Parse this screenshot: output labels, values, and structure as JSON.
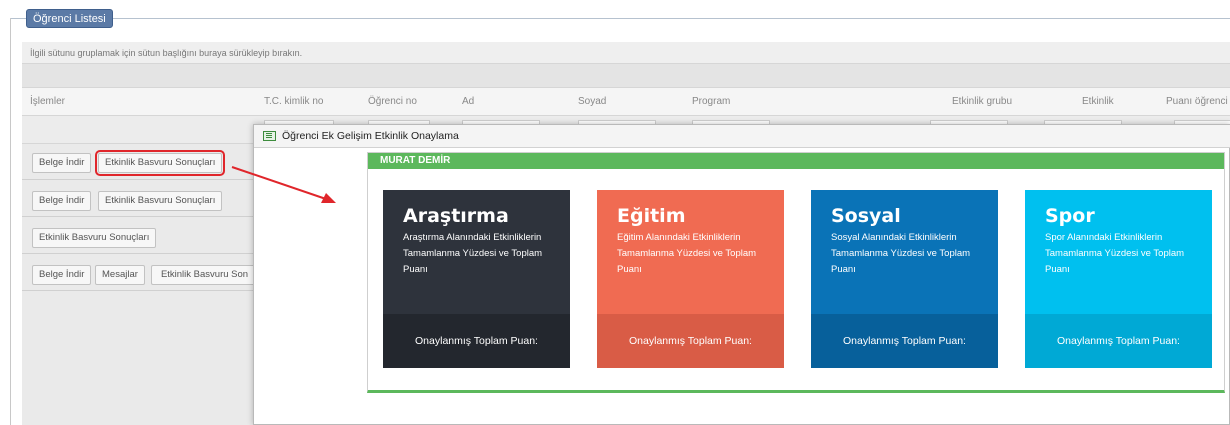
{
  "fieldset": {
    "legend": "Öğrenci Listesi"
  },
  "grid": {
    "group_hint": "İlgili sütunu gruplamak için sütun başlığını buraya sürükleyip bırakın.",
    "columns": [
      "İşlemler",
      "T.C. kimlik no",
      "Öğrenci no",
      "Ad",
      "Soyad",
      "Program",
      "Etkinlik grubu",
      "Etkinlik",
      "Puanı öğrenci"
    ],
    "rows": [
      {
        "buttons": [
          "Belge İndir",
          "Etkinlik Basvuru Sonuçları"
        ]
      },
      {
        "buttons": [
          "Belge İndir",
          "Etkinlik Basvuru Sonuçları"
        ]
      },
      {
        "buttons": [
          "Etkinlik Basvuru Sonuçları"
        ]
      },
      {
        "buttons": [
          "Belge İndir",
          "Mesajlar",
          "Etkinlik Basvuru Son"
        ]
      }
    ]
  },
  "modal": {
    "title": "Öğrenci Ek Gelişim Etkinlik Onaylama",
    "panel_header": "MURAT DEMİR",
    "cards": [
      {
        "title": "Araştırma",
        "description": "Araştırma Alanındaki Etkinliklerin Tamamlanma Yüzdesi ve Toplam Puanı",
        "footer": "Onaylanmış Toplam Puan:",
        "color": "#2e333c",
        "footer_color": "#23272e",
        "desc_color": "#ffffff"
      },
      {
        "title": "Eğitim",
        "description": "Eğitim Alanındaki Etkinliklerin Tamamlanma Yüzdesi ve Toplam Puanı",
        "footer": "Onaylanmış Toplam Puan:",
        "color": "#f06b52",
        "footer_color": "#d95c46",
        "desc_color": "#ffffff"
      },
      {
        "title": "Sosyal",
        "description": "Sosyal Alanındaki Etkinliklerin Tamamlanma Yüzdesi ve Toplam Puanı",
        "footer": "Onaylanmış Toplam Puan:",
        "color": "#0a73b7",
        "footer_color": "#07609b",
        "desc_color": "#ffffff"
      },
      {
        "title": "Spor",
        "description": "Spor Alanındaki Etkinliklerin Tamamlanma Yüzdesi ve Toplam Puanı",
        "footer": "Onaylanmış Toplam Puan:",
        "color": "#00c0ef",
        "footer_color": "#00a9d5",
        "desc_color": "#ffffff"
      }
    ]
  },
  "colors": {
    "highlight": "#e0262b",
    "legend": "#5b7aa6",
    "panel_green": "#5cb85c"
  }
}
